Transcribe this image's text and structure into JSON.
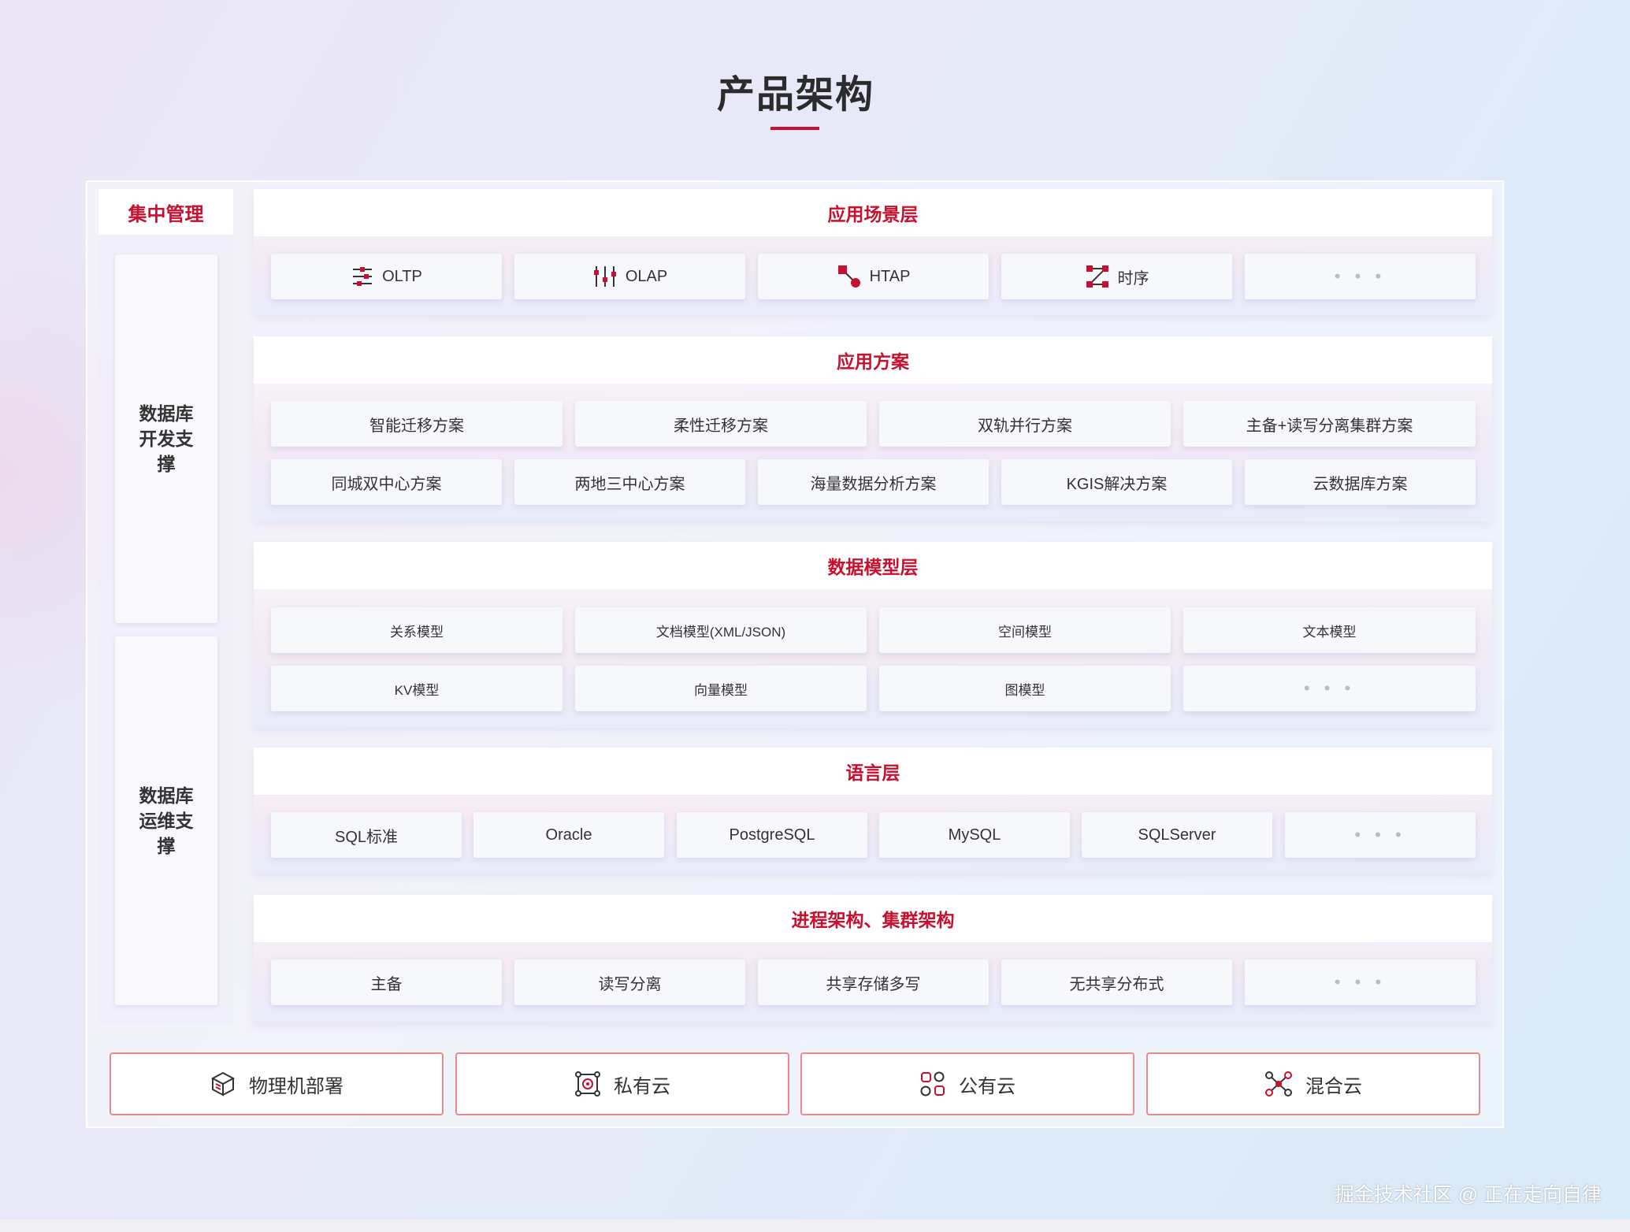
{
  "title": "产品架构",
  "side": {
    "header": "集中管理",
    "dev_support": "数据库开发支撑",
    "ops_support": "数据库运维支撑"
  },
  "layers": {
    "scenario": {
      "title": "应用场景层",
      "items": [
        "OLTP",
        "OLAP",
        "HTAP",
        "时序",
        "• • •"
      ],
      "icons": [
        "sliders-icon",
        "vertical-sliders-icon",
        "htap-icon",
        "timeseries-icon"
      ]
    },
    "solution": {
      "title": "应用方案",
      "row1": [
        "智能迁移方案",
        "柔性迁移方案",
        "双轨并行方案",
        "主备+读写分离集群方案"
      ],
      "row2": [
        "同城双中心方案",
        "两地三中心方案",
        "海量数据分析方案",
        "KGIS解决方案",
        "云数据库方案"
      ]
    },
    "model": {
      "title": "数据模型层",
      "row1": [
        "关系模型",
        "文档模型(XML/JSON)",
        "空间模型",
        "文本模型"
      ],
      "row2": [
        "KV模型",
        "向量模型",
        "图模型",
        "• • •"
      ]
    },
    "language": {
      "title": "语言层",
      "items": [
        "SQL标准",
        "Oracle",
        "PostgreSQL",
        "MySQL",
        "SQLServer",
        "• • •"
      ]
    },
    "cluster": {
      "title": "进程架构、集群架构",
      "items": [
        "主备",
        "读写分离",
        "共享存储多写",
        "无共享分布式",
        "• • •"
      ]
    }
  },
  "deploy": [
    "物理机部署",
    "私有云",
    "公有云",
    "混合云"
  ],
  "deploy_icons": [
    "cube-icon",
    "private-cloud-icon",
    "public-cloud-icon",
    "hybrid-cloud-icon"
  ],
  "watermark": "掘金技术社区 @ 正在走向自律",
  "colors": {
    "accent": "#c8102e",
    "border": "#e58a8f"
  }
}
